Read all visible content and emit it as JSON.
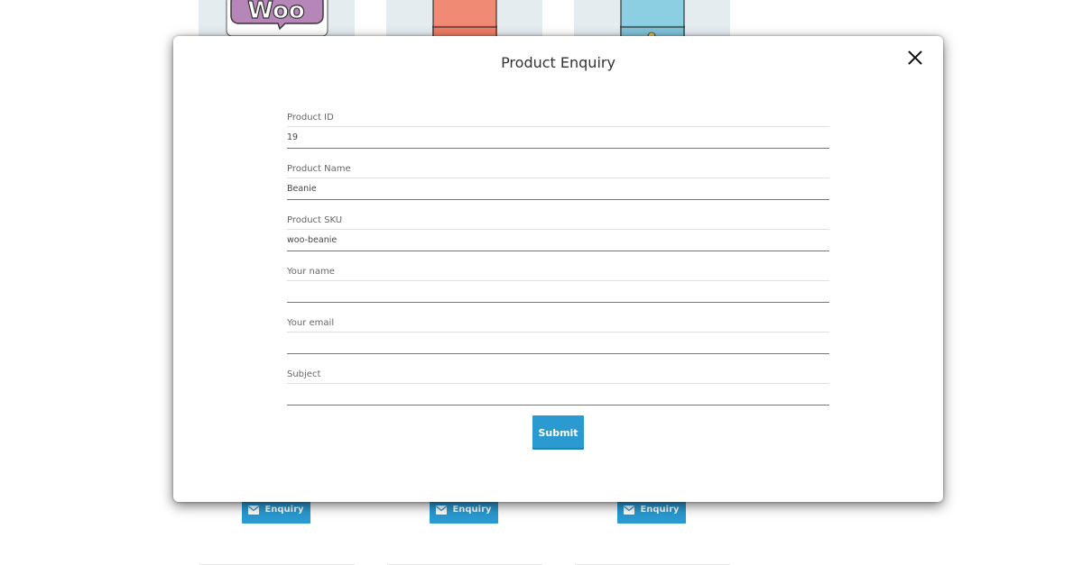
{
  "background": {
    "products": [
      {
        "thumb_name": "woo-logo-thumb",
        "logo_text": "Woo",
        "enquiry_label": "Enquiry"
      },
      {
        "thumb_name": "red-beanie-thumb",
        "enquiry_label": "Enquiry"
      },
      {
        "thumb_name": "blue-beanie-thumb",
        "enquiry_label": "Enquiry"
      }
    ]
  },
  "modal": {
    "title": "Product Enquiry",
    "close_icon": "close-icon",
    "fields": [
      {
        "label": "Product ID",
        "value": "19",
        "placeholder": ""
      },
      {
        "label": "Product Name",
        "value": "Beanie",
        "placeholder": ""
      },
      {
        "label": "Product SKU",
        "value": "woo-beanie",
        "placeholder": ""
      },
      {
        "label": "Your name",
        "value": "",
        "placeholder": ""
      },
      {
        "label": "Your email",
        "value": "",
        "placeholder": ""
      },
      {
        "label": "Subject",
        "value": "",
        "placeholder": ""
      }
    ],
    "submit_label": "Submit"
  },
  "colors": {
    "accent": "#2a9ad0",
    "thumb_background": "#e5ecf0"
  }
}
